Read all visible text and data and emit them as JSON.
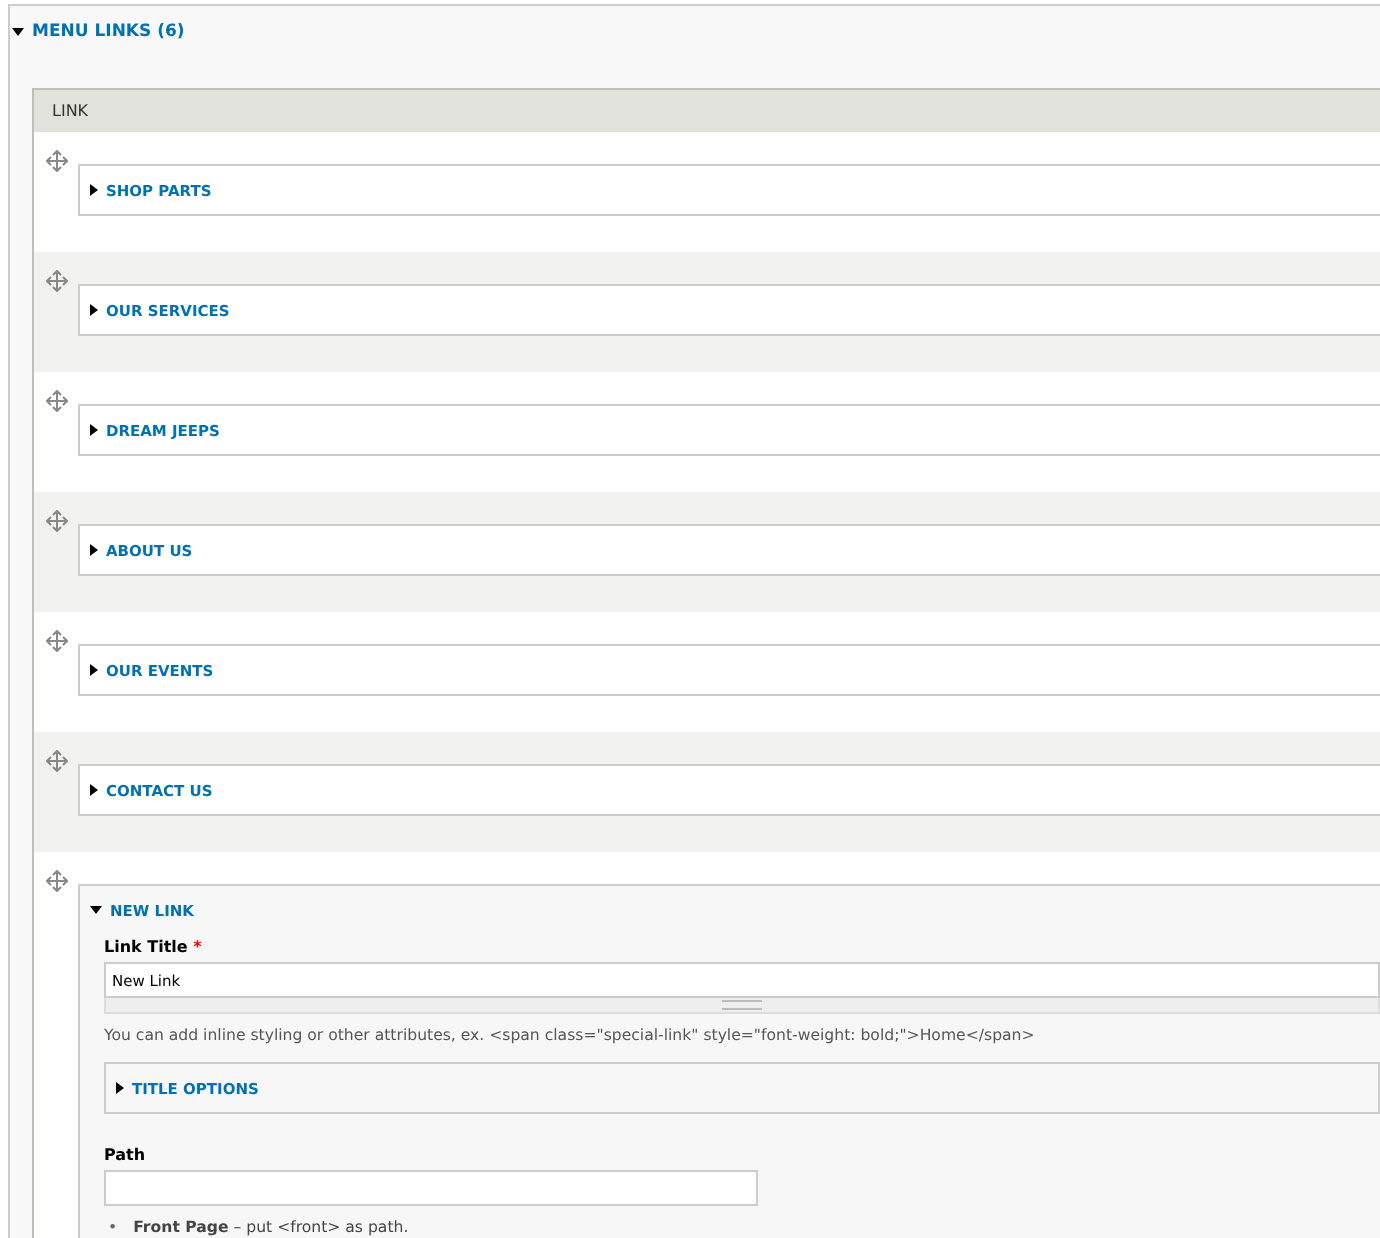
{
  "fieldset": {
    "legend": "MENU LINKS (6)",
    "expanded": true
  },
  "table": {
    "header": "LINK",
    "rows": [
      {
        "title": "SHOP PARTS",
        "expanded": false
      },
      {
        "title": "OUR SERVICES",
        "expanded": false
      },
      {
        "title": "DREAM JEEPS",
        "expanded": false
      },
      {
        "title": "ABOUT US",
        "expanded": false
      },
      {
        "title": "OUR EVENTS",
        "expanded": false
      },
      {
        "title": "CONTACT US",
        "expanded": false
      },
      {
        "title": "NEW LINK",
        "expanded": true
      }
    ]
  },
  "form": {
    "link_title": {
      "label": "Link Title",
      "required_mark": "*",
      "value": "New Link",
      "description": "You can add inline styling or other attributes, ex. <span class=\"special-link\" style=\"font-weight: bold;\">Home</span>"
    },
    "title_options": {
      "title": "TITLE OPTIONS",
      "expanded": false
    },
    "path": {
      "label": "Path"
    },
    "hints": [
      {
        "marker": "•",
        "text": "**Front Page** – put <front> as path."
      }
    ]
  }
}
